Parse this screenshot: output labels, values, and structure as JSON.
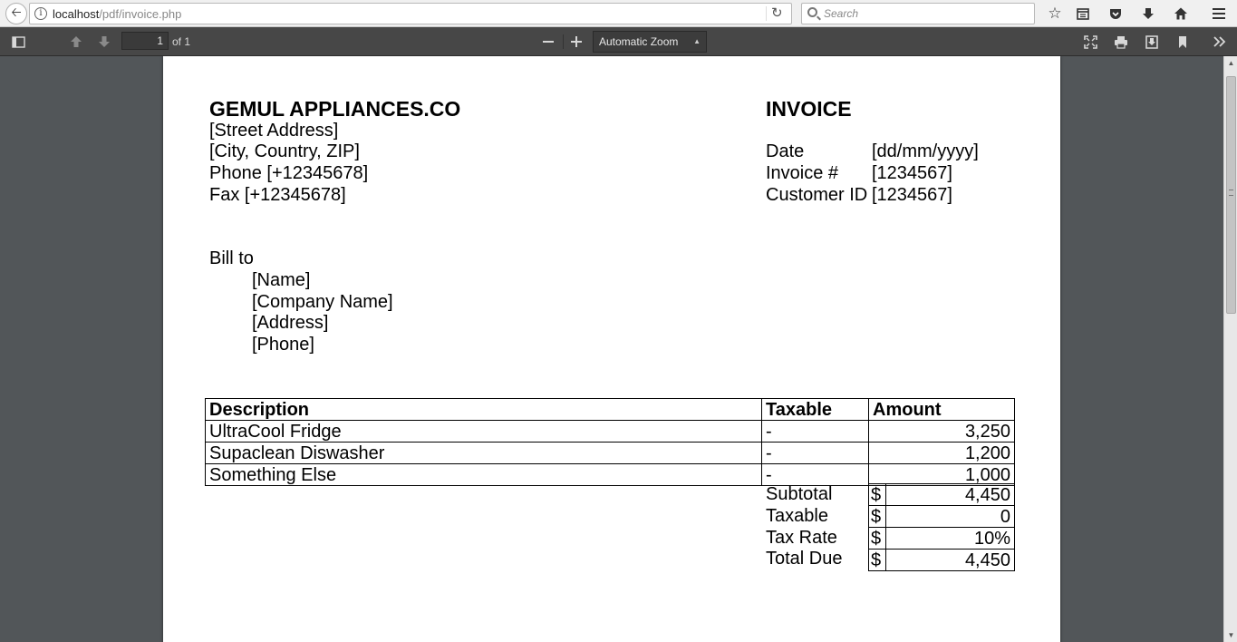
{
  "browser": {
    "url_host": "localhost",
    "url_path": "/pdf/invoice.php",
    "search_placeholder": "Search"
  },
  "pdf_toolbar": {
    "page_number": "1",
    "page_count": "of 1",
    "zoom_label": "Automatic Zoom"
  },
  "company": {
    "name": "GEMUL APPLIANCES.CO",
    "street": "[Street Address]",
    "city": "[City, Country, ZIP]",
    "phone": "Phone [+12345678]",
    "fax": "Fax [+12345678]"
  },
  "invoice": {
    "title": "INVOICE",
    "fields": [
      {
        "label": "Date",
        "value": "[dd/mm/yyyy]"
      },
      {
        "label": "Invoice #",
        "value": "[1234567]"
      },
      {
        "label": "Customer ID",
        "value": "[1234567]"
      }
    ]
  },
  "bill_to": {
    "heading": "Bill to",
    "lines": [
      "[Name]",
      "[Company Name]",
      "[Address]",
      "[Phone]"
    ]
  },
  "items_table": {
    "headers": [
      "Description",
      "Taxable",
      "Amount"
    ],
    "rows": [
      {
        "description": "UltraCool Fridge",
        "taxable": "-",
        "amount": "3,250"
      },
      {
        "description": "Supaclean Diswasher",
        "taxable": "-",
        "amount": "1,200"
      },
      {
        "description": "Something Else",
        "taxable": "-",
        "amount": "1,000"
      }
    ]
  },
  "totals": [
    {
      "label": "Subtotal",
      "currency": "$",
      "value": "4,450"
    },
    {
      "label": "Taxable",
      "currency": "$",
      "value": "0"
    },
    {
      "label": "Tax Rate",
      "currency": "$",
      "value": "10%"
    },
    {
      "label": "Total Due",
      "currency": "$",
      "value": "4,450"
    }
  ]
}
